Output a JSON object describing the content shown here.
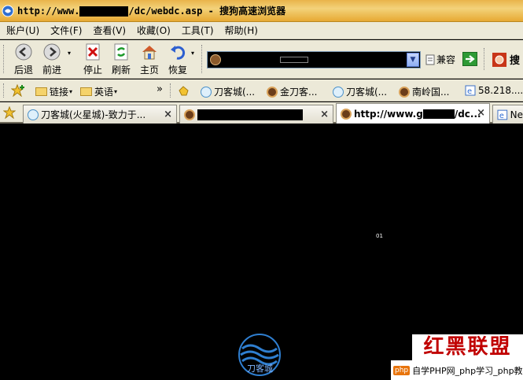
{
  "window": {
    "title_prefix": "http://www.",
    "title_suffix": "/dc/webdc.asp - 搜狗高速浏览器"
  },
  "menu": [
    "账户(U)",
    "文件(F)",
    "查看(V)",
    "收藏(O)",
    "工具(T)",
    "帮助(H)"
  ],
  "toolbar": {
    "back": "后退",
    "forward": "前进",
    "stop": "停止",
    "refresh": "刷新",
    "home": "主页",
    "restore": "恢复",
    "compat": "兼容",
    "search_cut": "搜"
  },
  "links": {
    "links_label": "链接",
    "english_label": "英语",
    "more": "»",
    "items": [
      "刀客城(...",
      "金刀客...",
      "刀客城(...",
      "南岭国...",
      "58.218...."
    ]
  },
  "tabs": [
    {
      "label": "刀客城(火星城)-致力于...",
      "close": "×"
    },
    {
      "label": "",
      "close": "×"
    },
    {
      "label": "http://www.g",
      "label_tail": "/dc...",
      "close": "×"
    },
    {
      "label": "Ne"
    }
  ],
  "content": {
    "dot_text": "01",
    "logo_text": "刀客城"
  },
  "watermark": {
    "brand": "红黑联盟",
    "line": "自学PHP网_php学习_php教程"
  },
  "colors": {
    "title_bar": "#e9b44a",
    "chrome": "#ece9d8",
    "page_bg": "#000000",
    "watermark_red": "#c00000"
  }
}
